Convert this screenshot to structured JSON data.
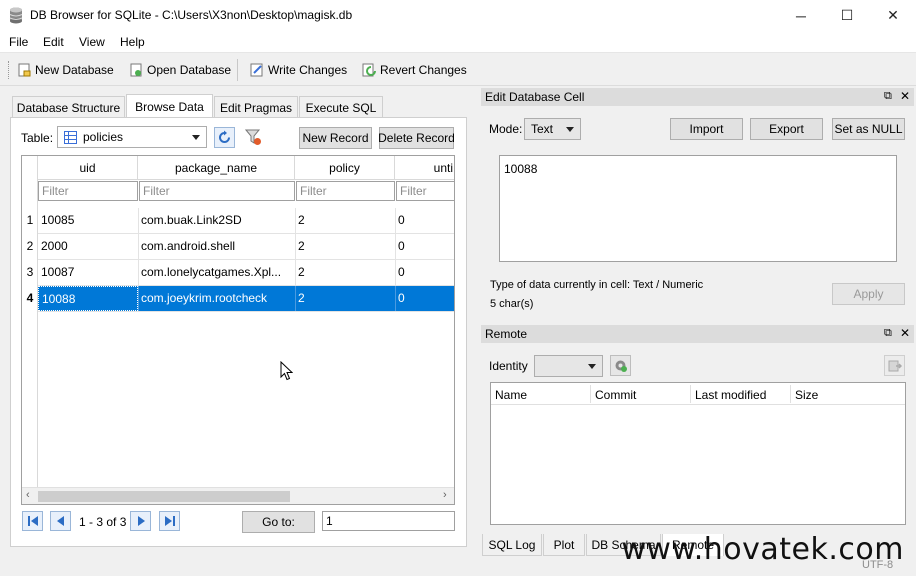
{
  "window": {
    "title": "DB Browser for SQLite - C:\\Users\\X3non\\Desktop\\magisk.db",
    "minimize_glyph": "─",
    "maximize_glyph": "☐",
    "close_glyph": "✕"
  },
  "menu": [
    "File",
    "Edit",
    "View",
    "Help"
  ],
  "toolbar": {
    "new_database": "New Database",
    "open_database": "Open Database",
    "write_changes": "Write Changes",
    "revert_changes": "Revert Changes"
  },
  "tabs": [
    "Database Structure",
    "Browse Data",
    "Edit Pragmas",
    "Execute SQL"
  ],
  "browse": {
    "table_label": "Table:",
    "table_value": "policies",
    "new_record": "New Record",
    "delete_record": "Delete Record",
    "columns": [
      "uid",
      "package_name",
      "policy",
      "unti"
    ],
    "filter_placeholder": "Filter",
    "row_numbers": [
      "1",
      "2",
      "3",
      "4"
    ],
    "rows": [
      [
        "10085",
        "com.buak.Link2SD",
        "2",
        "0"
      ],
      [
        "2000",
        "com.android.shell",
        "2",
        "0"
      ],
      [
        "10087",
        "com.lonelycatgames.Xpl...",
        "2",
        "0"
      ],
      [
        "10088",
        "com.joeykrim.rootcheck",
        "2",
        "0"
      ]
    ],
    "selected_row_index": 3,
    "pagination": "1 - 3 of 3",
    "goto_label": "Go to:",
    "goto_value": "1"
  },
  "edit_cell": {
    "title": "Edit Database Cell",
    "mode_label": "Mode:",
    "mode_value": "Text",
    "import": "Import",
    "export": "Export",
    "set_null": "Set as NULL",
    "content": "10088",
    "type_info": "Type of data currently in cell: Text / Numeric",
    "size_info": "5 char(s)",
    "apply": "Apply"
  },
  "remote": {
    "title": "Remote",
    "identity_label": "Identity",
    "columns": [
      "Name",
      "Commit",
      "Last modified",
      "Size"
    ]
  },
  "bottom_tabs": [
    "SQL Log",
    "Plot",
    "DB Schema",
    "Remote"
  ],
  "status": {
    "encoding": "UTF-8"
  },
  "watermark": "www.hovatek.com",
  "colors": {
    "selection": "#0078d7",
    "accent": "#0078d7"
  }
}
